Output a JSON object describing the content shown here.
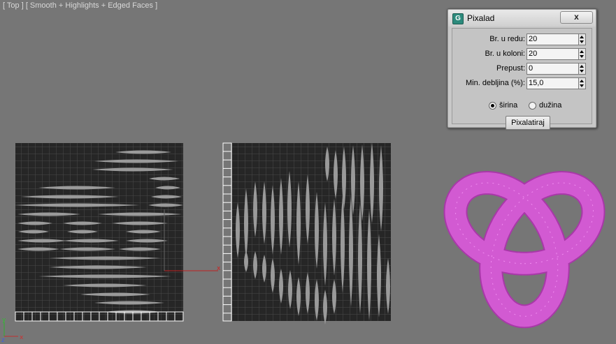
{
  "viewport": {
    "label": "[ Top ] [ Smooth + Highlights + Edged Faces ]",
    "axis_x": "x",
    "axis_y": "y",
    "axis_z": "z"
  },
  "dialog": {
    "title": "Pixalad",
    "close_label": "x",
    "fields": [
      {
        "label": "Br. u redu:",
        "value": "20"
      },
      {
        "label": "Br. u koloni:",
        "value": "20"
      },
      {
        "label": "Prepust:",
        "value": "0"
      },
      {
        "label": "Min. debljina (%):",
        "value": "15,0"
      }
    ],
    "radio_options": [
      {
        "label": "širina",
        "selected": true
      },
      {
        "label": "dužina",
        "selected": false
      }
    ],
    "action_label": "Pixalatiraj"
  },
  "colors": {
    "viewport_bg": "#767676",
    "grid_dark": "#262626",
    "pixel_gray": "#9a9a9a",
    "knot": "#d25ad2",
    "knot_edge": "#ff8cff"
  }
}
